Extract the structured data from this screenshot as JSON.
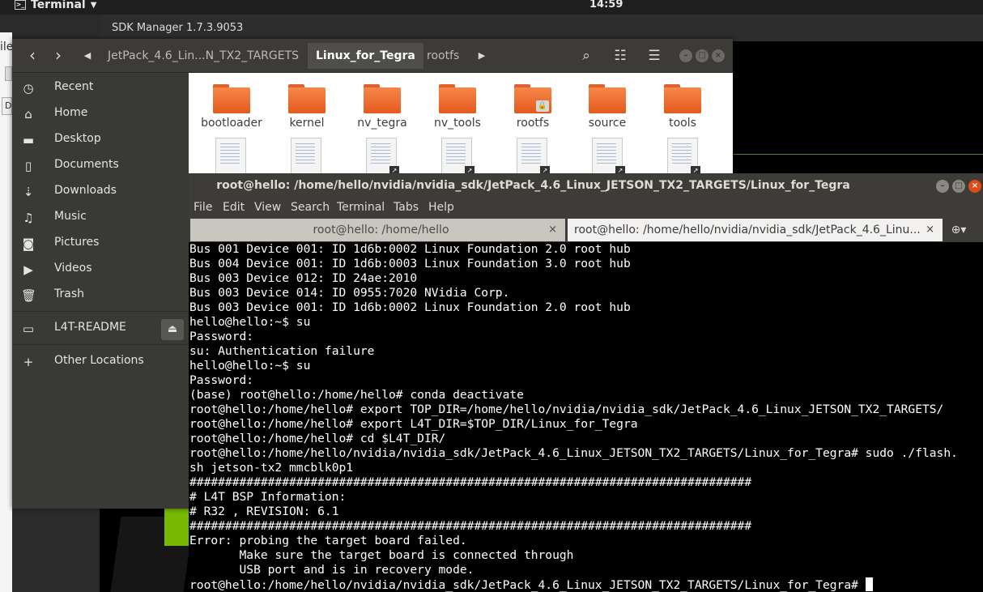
{
  "topbar": {
    "app_name": "Terminal",
    "clock": "14:59"
  },
  "sdk_window": {
    "title": "SDK Manager 1.7.3.9053"
  },
  "left_strip": {
    "partial_label": "ile",
    "button_label": "D"
  },
  "file_manager": {
    "breadcrumbs": [
      {
        "label": "JetPack_4.6_Lin...N_TX2_TARGETS"
      },
      {
        "label": "Linux_for_Tegra"
      },
      {
        "label": "rootfs"
      }
    ],
    "sidebar": {
      "items": [
        {
          "label": "Recent",
          "icon": "clock-icon"
        },
        {
          "label": "Home",
          "icon": "home-icon"
        },
        {
          "label": "Desktop",
          "icon": "desktop-folder-icon"
        },
        {
          "label": "Documents",
          "icon": "document-icon"
        },
        {
          "label": "Downloads",
          "icon": "download-icon"
        },
        {
          "label": "Music",
          "icon": "music-icon"
        },
        {
          "label": "Pictures",
          "icon": "camera-icon"
        },
        {
          "label": "Videos",
          "icon": "video-icon"
        },
        {
          "label": "Trash",
          "icon": "trash-icon"
        }
      ],
      "device": {
        "label": "L4T-README",
        "icon": "drive-icon"
      },
      "other": {
        "label": "Other Locations",
        "icon": "plus-icon"
      }
    },
    "folders": [
      {
        "name": "bootloader",
        "locked": false
      },
      {
        "name": "kernel",
        "locked": false
      },
      {
        "name": "nv_tegra",
        "locked": false
      },
      {
        "name": "nv_tools",
        "locked": false
      },
      {
        "name": "rootfs",
        "locked": true
      },
      {
        "name": "source",
        "locked": false
      },
      {
        "name": "tools",
        "locked": false
      }
    ]
  },
  "terminal": {
    "title": "root@hello: /home/hello/nvidia/nvidia_sdk/JetPack_4.6_Linux_JETSON_TX2_TARGETS/Linux_for_Tegra",
    "menu": [
      "File",
      "Edit",
      "View",
      "Search",
      "Terminal",
      "Tabs",
      "Help"
    ],
    "tabs": [
      {
        "label": "root@hello: /home/hello",
        "active": false
      },
      {
        "label": "root@hello: /home/hello/nvidia/nvidia_sdk/JetPack_4.6_Linu...",
        "active": true
      }
    ],
    "lines": [
      "Bus 001 Device 001: ID 1d6b:0002 Linux Foundation 2.0 root hub",
      "Bus 004 Device 001: ID 1d6b:0003 Linux Foundation 3.0 root hub",
      "Bus 003 Device 012: ID 24ae:2010",
      "Bus 003 Device 014: ID 0955:7020 NVidia Corp.",
      "Bus 003 Device 001: ID 1d6b:0002 Linux Foundation 2.0 root hub",
      "hello@hello:~$ su",
      "Password:",
      "su: Authentication failure",
      "hello@hello:~$ su",
      "Password:",
      "(base) root@hello:/home/hello# conda deactivate",
      "root@hello:/home/hello# export TOP_DIR=/home/hello/nvidia/nvidia_sdk/JetPack_4.6_Linux_JETSON_TX2_TARGETS/",
      "root@hello:/home/hello# export L4T_DIR=$TOP_DIR/Linux_for_Tegra",
      "root@hello:/home/hello# cd $L4T_DIR/",
      "root@hello:/home/hello/nvidia/nvidia_sdk/JetPack_4.6_Linux_JETSON_TX2_TARGETS/Linux_for_Tegra# sudo ./flash.",
      "sh jetson-tx2 mmcblk0p1",
      "###############################################################################",
      "# L4T BSP Information:",
      "# R32 , REVISION: 6.1",
      "###############################################################################",
      "Error: probing the target board failed.",
      "       Make sure the target board is connected through",
      "       USB port and is in recovery mode.",
      "root@hello:/home/hello/nvidia/nvidia_sdk/JetPack_4.6_Linux_JETSON_TX2_TARGETS/Linux_for_Tegra# "
    ]
  }
}
